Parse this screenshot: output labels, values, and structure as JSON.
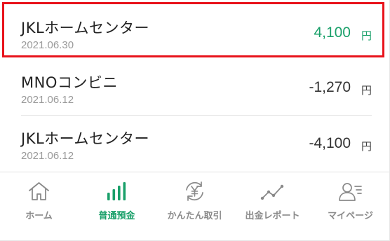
{
  "transactions": [
    {
      "merchant": "JKLホームセンター",
      "date": "2021.06.30",
      "amount": "4,100",
      "unit": "円",
      "kind": "deposit"
    },
    {
      "merchant": "MNOコンビニ",
      "date": "2021.06.12",
      "amount": "-1,270",
      "unit": "円",
      "kind": "withdrawal"
    },
    {
      "merchant": "JKLホームセンター",
      "date": "2021.06.12",
      "amount": "-4,100",
      "unit": "円",
      "kind": "withdrawal"
    }
  ],
  "tabbar": {
    "active": "普通預金",
    "tabs": [
      {
        "label": "ホーム",
        "icon": "home-icon"
      },
      {
        "label": "普通預金",
        "icon": "bar-chart-icon"
      },
      {
        "label": "かんたん取引",
        "icon": "yen-exchange-icon"
      },
      {
        "label": "出金レポート",
        "icon": "line-graph-icon"
      },
      {
        "label": "マイページ",
        "icon": "user-list-icon"
      }
    ]
  },
  "colors": {
    "accent": "#1aa06a",
    "highlight": "#e8131b",
    "muted": "#8a8a8a"
  }
}
